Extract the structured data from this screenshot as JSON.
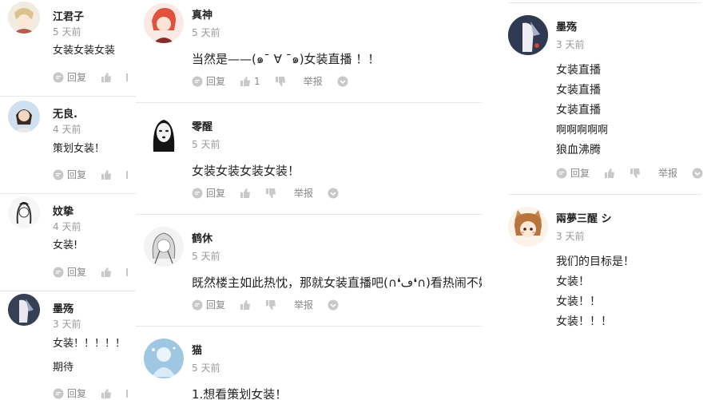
{
  "labels": {
    "reply": "回复",
    "report": "举报"
  },
  "col1": [
    {
      "user": "江君子",
      "time": "5 天前",
      "lines": [
        "女装女装女装"
      ]
    },
    {
      "user": "无良.",
      "time": "4 天前",
      "lines": [
        "策划女装！"
      ]
    },
    {
      "user": "妏挚",
      "time": "4 天前",
      "lines": [
        "女装!"
      ]
    },
    {
      "user": "墨殇",
      "time": "3 天前",
      "lines": [
        "女装！！！！！",
        "期待"
      ]
    }
  ],
  "col2": [
    {
      "user": "真神",
      "time": "5 天前",
      "lines": [
        "当然是——(๑¯ ∀ ¯๑)女装直播 ！！"
      ],
      "likes": "1"
    },
    {
      "user": "零醒",
      "time": "5 天前",
      "lines": [
        "女装女装女装女装！"
      ]
    },
    {
      "user": "鹤休",
      "time": "5 天前",
      "lines": [
        "既然楼主如此热忱，那就女装直播吧(∩❛ڡ❛∩)看热闹不嫌事大"
      ]
    },
    {
      "user": "猫",
      "time": "5 天前",
      "lines": [
        "1.想看策划女装！"
      ]
    }
  ],
  "col3": [
    {
      "user": "墨殇",
      "time": "3 天前",
      "lines": [
        "女装直播",
        "女装直播",
        "女装直播",
        "啊啊啊啊啊",
        "狼血沸腾"
      ]
    },
    {
      "user": "兩夢三醒 シ",
      "time": "3 天前",
      "lines": [
        "我们的目标是！",
        "女装！",
        "女装！！",
        "女装！！！"
      ]
    }
  ],
  "colors": {
    "divider": "#e8e8e8",
    "meta": "#999999",
    "icon": "#c8c8c8"
  }
}
